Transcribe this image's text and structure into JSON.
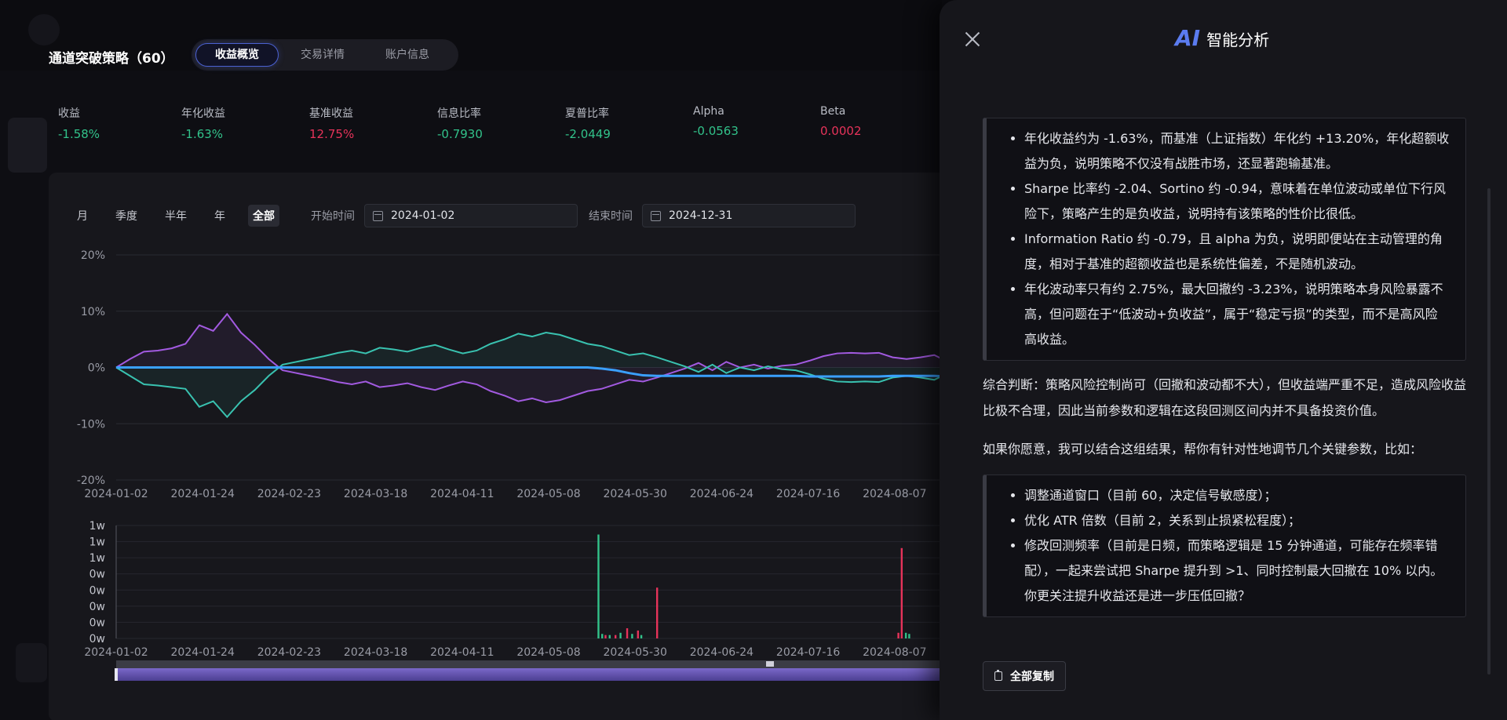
{
  "strategy": {
    "title": "通道突破策略（60）",
    "tabs": [
      "收益概览",
      "交易详情",
      "账户信息"
    ],
    "active_tab": 0
  },
  "metrics": [
    {
      "label": "收益",
      "value": "-1.58%",
      "sign": "neg"
    },
    {
      "label": "年化收益",
      "value": "-1.63%",
      "sign": "neg"
    },
    {
      "label": "基准收益",
      "value": "12.75%",
      "sign": "pos"
    },
    {
      "label": "信息比率",
      "value": "-0.7930",
      "sign": "neg"
    },
    {
      "label": "夏普比率",
      "value": "-2.0449",
      "sign": "neg"
    },
    {
      "label": "Alpha",
      "value": "-0.0563",
      "sign": "neg"
    },
    {
      "label": "Beta",
      "value": "0.0002",
      "sign": "pos"
    }
  ],
  "period_filter": {
    "options": [
      "月",
      "季度",
      "半年",
      "年",
      "全部"
    ],
    "active": "全部",
    "start_label": "开始时间",
    "start_value": "2024-01-02",
    "end_label": "结束时间",
    "end_value": "2024-12-31"
  },
  "chart_data": [
    {
      "type": "line",
      "x_tick_labels": [
        "2024-01-02",
        "2024-01-24",
        "2024-02-23",
        "2024-03-18",
        "2024-04-11",
        "2024-05-08",
        "2024-05-30",
        "2024-06-24",
        "2024-07-16",
        "2024-08-07"
      ],
      "y_tick_labels": [
        "20%",
        "10%",
        "0%",
        "-10%",
        "-20%"
      ],
      "ylim": [
        -20,
        20
      ],
      "series": [
        {
          "color": "#3aa0ff",
          "values": [
            0,
            0,
            0,
            0,
            0,
            0,
            0,
            0,
            0,
            0,
            0,
            0,
            0,
            0,
            0,
            0,
            0,
            0,
            0,
            0,
            0,
            0,
            0,
            0,
            0,
            0,
            0,
            0,
            0,
            0,
            0,
            0,
            0,
            0,
            0,
            -0.2,
            -0.5,
            -1.0,
            -1.4,
            -1.5,
            -1.5,
            -1.5,
            -1.5,
            -1.5,
            -1.5,
            -1.5,
            -1.5,
            -1.5,
            -1.5,
            -1.5,
            -1.6,
            -1.6,
            -1.6,
            -1.6,
            -1.6,
            -1.6,
            -1.5,
            -1.5,
            -1.5,
            -1.5,
            -1.6
          ]
        },
        {
          "color": "#39c2b0",
          "values": [
            0,
            -1.5,
            -3.0,
            -3.2,
            -3.5,
            -3.8,
            -7.0,
            -6.0,
            -8.8,
            -6.0,
            -4.0,
            -1.5,
            0.5,
            1.0,
            1.5,
            2.0,
            2.6,
            3.0,
            2.5,
            3.5,
            3.2,
            2.8,
            3.5,
            4.0,
            3.2,
            2.5,
            3.0,
            4.2,
            5.0,
            6.0,
            5.5,
            6.2,
            5.8,
            5.0,
            4.2,
            3.8,
            3.0,
            2.2,
            2.5,
            1.8,
            1.0,
            0.2,
            -0.8,
            0.5,
            -1.0,
            0,
            -0.5,
            0.2,
            -0.3,
            -0.5,
            -1.2,
            -2.0,
            -2.5,
            -2.6,
            -2.5,
            -2.6,
            -1.8,
            -1.5,
            -1.8,
            -2.2,
            -1.0
          ]
        },
        {
          "color": "#a25ae0",
          "values": [
            0,
            1.5,
            2.8,
            3.0,
            3.4,
            4.2,
            7.5,
            6.5,
            9.5,
            6.2,
            4.0,
            1.5,
            -0.5,
            -1.0,
            -1.5,
            -2.0,
            -2.6,
            -3.0,
            -2.5,
            -3.5,
            -3.2,
            -2.8,
            -3.5,
            -4.0,
            -3.2,
            -2.5,
            -3.0,
            -4.2,
            -5.0,
            -6.0,
            -5.5,
            -6.2,
            -5.8,
            -5.0,
            -4.2,
            -3.8,
            -3.0,
            -2.2,
            -2.5,
            -1.8,
            -1.0,
            -0.2,
            0.8,
            -0.5,
            1.0,
            0,
            0.5,
            -0.2,
            0.3,
            0.5,
            1.2,
            2.0,
            2.5,
            2.6,
            2.5,
            2.6,
            1.8,
            1.5,
            1.8,
            2.2,
            1.0
          ]
        }
      ]
    },
    {
      "type": "bar",
      "x_tick_labels": [
        "2024-01-02",
        "2024-01-24",
        "2024-02-23",
        "2024-03-18",
        "2024-04-11",
        "2024-05-08",
        "2024-05-30",
        "2024-06-24",
        "2024-07-16",
        "2024-08-07"
      ],
      "y_tick_labels": [
        "1w",
        "1w",
        "1w",
        "0w",
        "0w",
        "0w",
        "0w",
        "0w"
      ],
      "ylim": [
        0,
        1.0
      ],
      "bars": [
        {
          "x": 0.5795,
          "value": 0.92,
          "color": "#32c28a"
        },
        {
          "x": 0.584,
          "value": 0.04,
          "color": "#32c28a"
        },
        {
          "x": 0.588,
          "value": 0.03,
          "color": "#e6335a"
        },
        {
          "x": 0.593,
          "value": 0.03,
          "color": "#32c28a"
        },
        {
          "x": 0.6,
          "value": 0.03,
          "color": "#e6335a"
        },
        {
          "x": 0.606,
          "value": 0.05,
          "color": "#32c28a"
        },
        {
          "x": 0.614,
          "value": 0.09,
          "color": "#e6335a"
        },
        {
          "x": 0.62,
          "value": 0.04,
          "color": "#32c28a"
        },
        {
          "x": 0.627,
          "value": 0.07,
          "color": "#e6335a"
        },
        {
          "x": 0.631,
          "value": 0.03,
          "color": "#32c28a"
        },
        {
          "x": 0.65,
          "value": 0.45,
          "color": "#e6335a"
        },
        {
          "x": 0.944,
          "value": 0.8,
          "color": "#e6335a"
        },
        {
          "x": 0.94,
          "value": 0.05,
          "color": "#e6335a"
        },
        {
          "x": 0.949,
          "value": 0.05,
          "color": "#32c28a"
        },
        {
          "x": 0.953,
          "value": 0.04,
          "color": "#32c28a"
        }
      ]
    }
  ],
  "ai_panel": {
    "logo": "AI",
    "title": "智能分析",
    "bullets_1": [
      "年化收益约为 -1.63%，而基准（上证指数）年化约 +13.20%，年化超额收益为负，说明策略不仅没有战胜市场，还显著跑输基准。",
      "Sharpe 比率约 -2.04、Sortino 约 -0.94，意味着在单位波动或单位下行风险下，策略产生的是负收益，说明持有该策略的性价比很低。",
      "Information Ratio 约 -0.79，且 alpha 为负，说明即便站在主动管理的角度，相对于基准的超额收益也是系统性偏差，不是随机波动。",
      "年化波动率只有约 2.75%，最大回撤约 -3.23%，说明策略本身风险暴露不高，但问题在于“低波动+负收益”，属于“稳定亏损”的类型，而不是高风险高收益。"
    ],
    "summary": "综合判断：策略风险控制尚可（回撤和波动都不大），但收益端严重不足，造成风险收益比极不合理，因此当前参数和逻辑在这段回测区间内并不具备投资价值。",
    "intro": "如果你愿意，我可以结合这组结果，帮你有针对性地调节几个关键参数，比如：",
    "bullets_2": [
      "调整通道窗口（目前 60，决定信号敏感度）；",
      "优化 ATR 倍数（目前 2，关系到止损紧松程度）；",
      "修改回测频率（目前是日频，而策略逻辑是 15 分钟通道，可能存在频率错配），一起来尝试把 Sharpe 提升到 >1、同时控制最大回撤在 10% 以内。你更关注提升收益还是进一步压低回撤？"
    ],
    "copy_label": "全部复制"
  }
}
